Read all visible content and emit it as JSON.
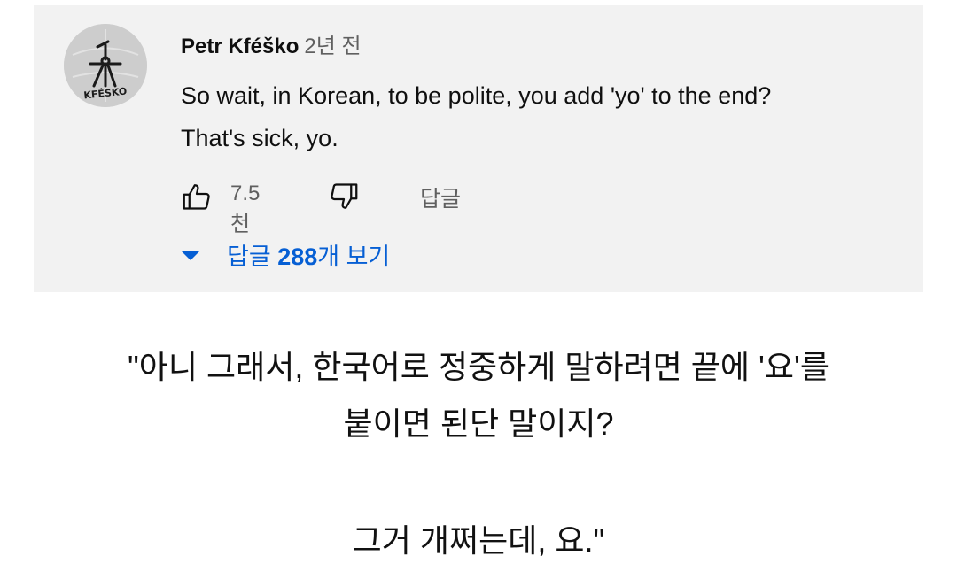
{
  "comment": {
    "avatar_text": "KFÉSKO",
    "author": "Petr Kféško",
    "timestamp": "2년 전",
    "text": "So wait, in Korean, to be polite, you add 'yo' to the end?\nThat's sick, yo.",
    "like_count": "7.5천",
    "reply_label": "답글",
    "replies_toggle": {
      "prefix": "답글 ",
      "count": "288",
      "suffix": "개 보기"
    },
    "colors": {
      "link": "#065fd4",
      "secondary_text": "#606060",
      "card_background": "#f2f2f2"
    },
    "icons": [
      "like-icon",
      "dislike-icon",
      "chevron-down-icon"
    ]
  },
  "caption": {
    "line1": "\"아니 그래서, 한국어로 정중하게 말하려면 끝에 '요'를",
    "line2": "붙이면 된단 말이지?",
    "line3": "그거 개쩌는데, 요.\""
  }
}
